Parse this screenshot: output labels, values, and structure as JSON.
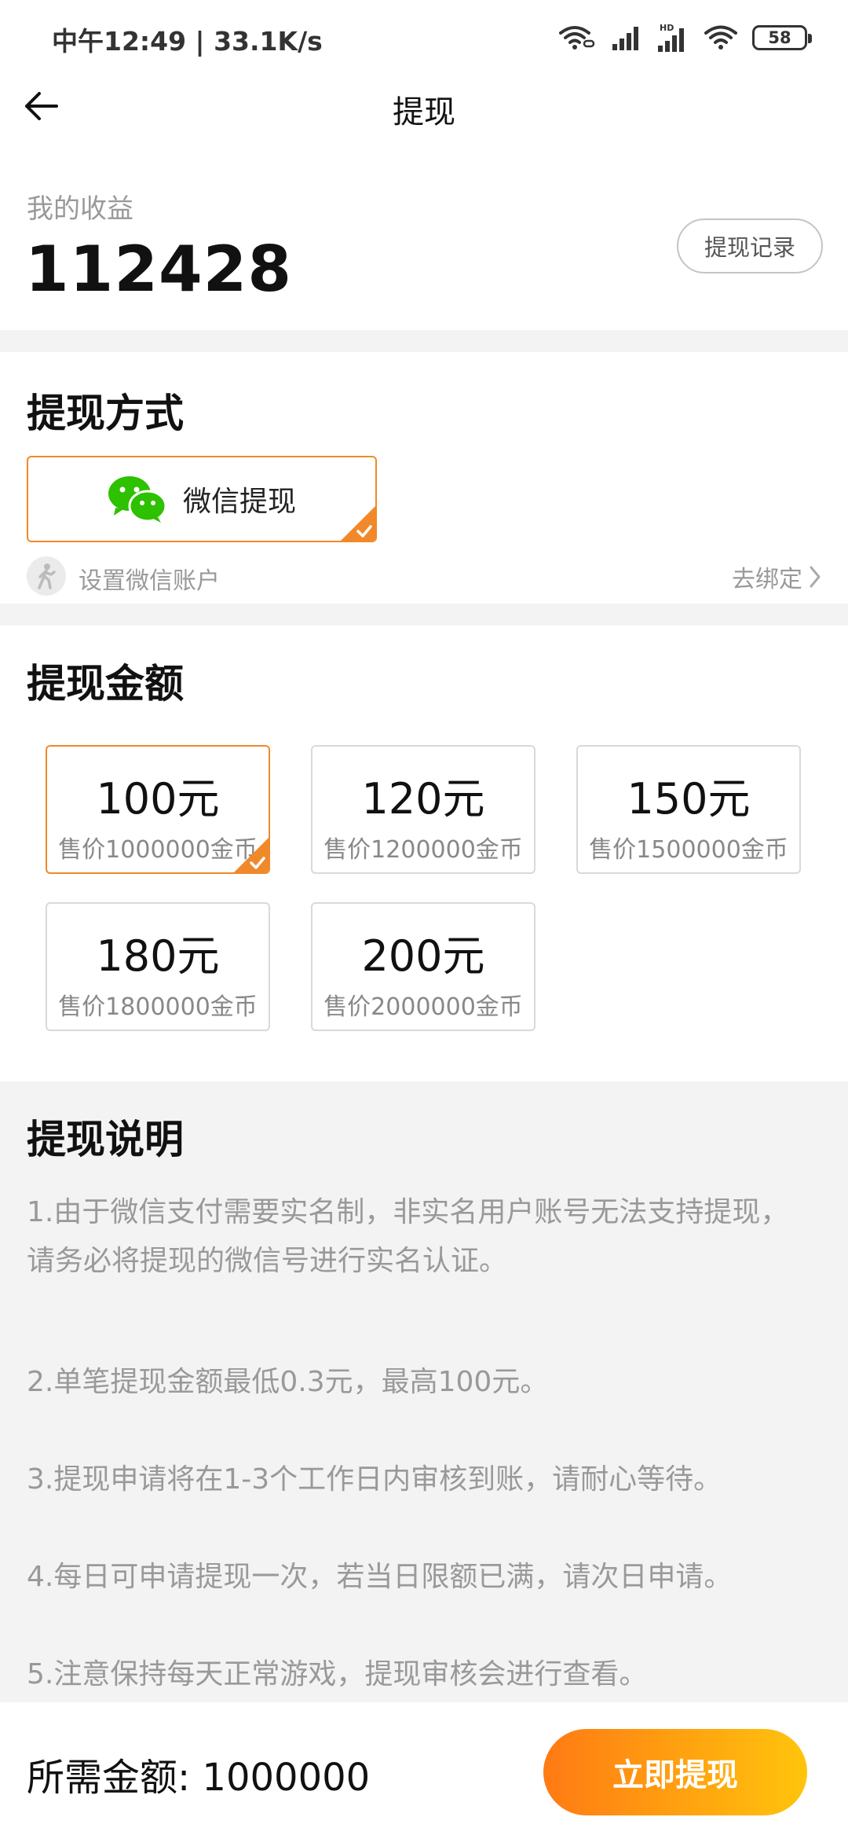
{
  "status_bar": {
    "time_speed": "中午12:49 | 33.1K/s",
    "hd_label": "HD",
    "battery": "58"
  },
  "nav": {
    "title": "提现"
  },
  "earnings": {
    "label": "我的收益",
    "value": "112428",
    "record_button": "提现记录"
  },
  "method": {
    "title": "提现方式",
    "option_label": "微信提现",
    "bind_label": "设置微信账户",
    "bind_link": "去绑定"
  },
  "amount": {
    "title": "提现金额",
    "options": [
      {
        "value": "100元",
        "price": "售价1000000金币",
        "selected": true
      },
      {
        "value": "120元",
        "price": "售价1200000金币",
        "selected": false
      },
      {
        "value": "150元",
        "price": "售价1500000金币",
        "selected": false
      },
      {
        "value": "180元",
        "price": "售价1800000金币",
        "selected": false
      },
      {
        "value": "200元",
        "price": "售价2000000金币",
        "selected": false
      }
    ]
  },
  "notes": {
    "title": "提现说明",
    "items": [
      "1.由于微信支付需要实名制，非实名用户账号无法支持提现，请务必将提现的微信号进行实名认证。",
      "2.单笔提现金额最低0.3元，最高100元。",
      "3.提现申请将在1-3个工作日内审核到账，请耐心等待。",
      "4.每日可申请提现一次，若当日限额已满，请次日申请。",
      "5.注意保持每天正常游戏，提现审核会进行查看。"
    ]
  },
  "footer": {
    "required_text": "所需金额: 1000000",
    "button_label": "立即提现"
  },
  "colors": {
    "accent": "#f0892a",
    "button_gradient_start": "#ff7a14",
    "button_gradient_end": "#ffc40c",
    "wechat_green": "#2dc100",
    "section_gap": "#f3f3f3"
  }
}
